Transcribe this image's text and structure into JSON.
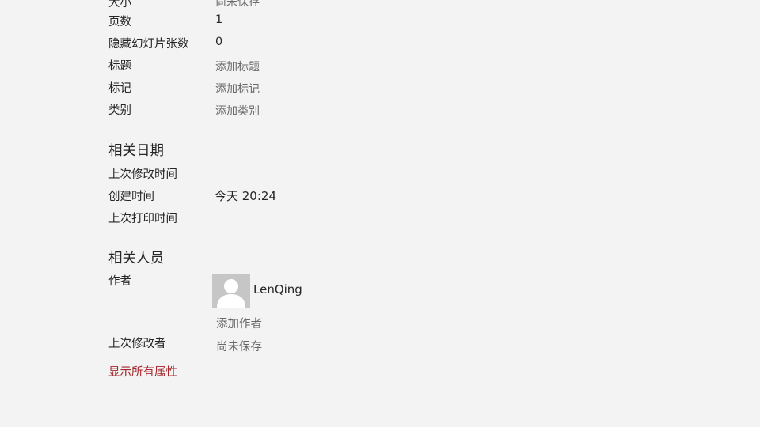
{
  "properties": {
    "size_label": "大小",
    "size_value": "尚未保存",
    "pages_label": "页数",
    "pages_value": "1",
    "hidden_slides_label": "隐藏幻灯片张数",
    "hidden_slides_value": "0",
    "title_label": "标题",
    "title_placeholder": "添加标题",
    "tags_label": "标记",
    "tags_placeholder": "添加标记",
    "category_label": "类别",
    "category_placeholder": "添加类别"
  },
  "related_dates": {
    "heading": "相关日期",
    "last_modified_label": "上次修改时间",
    "created_label": "创建时间",
    "created_value": "今天 20:24",
    "last_printed_label": "上次打印时间"
  },
  "related_people": {
    "heading": "相关人员",
    "author_label": "作者",
    "author_name": "LenQing",
    "add_author": "添加作者",
    "last_modified_by_label": "上次修改者",
    "last_modified_by_value": "尚未保存"
  },
  "show_all_link": "显示所有属性",
  "colors": {
    "background": "#f3f3f3",
    "link": "#a4262c",
    "placeholder": "#6a6a6a"
  }
}
